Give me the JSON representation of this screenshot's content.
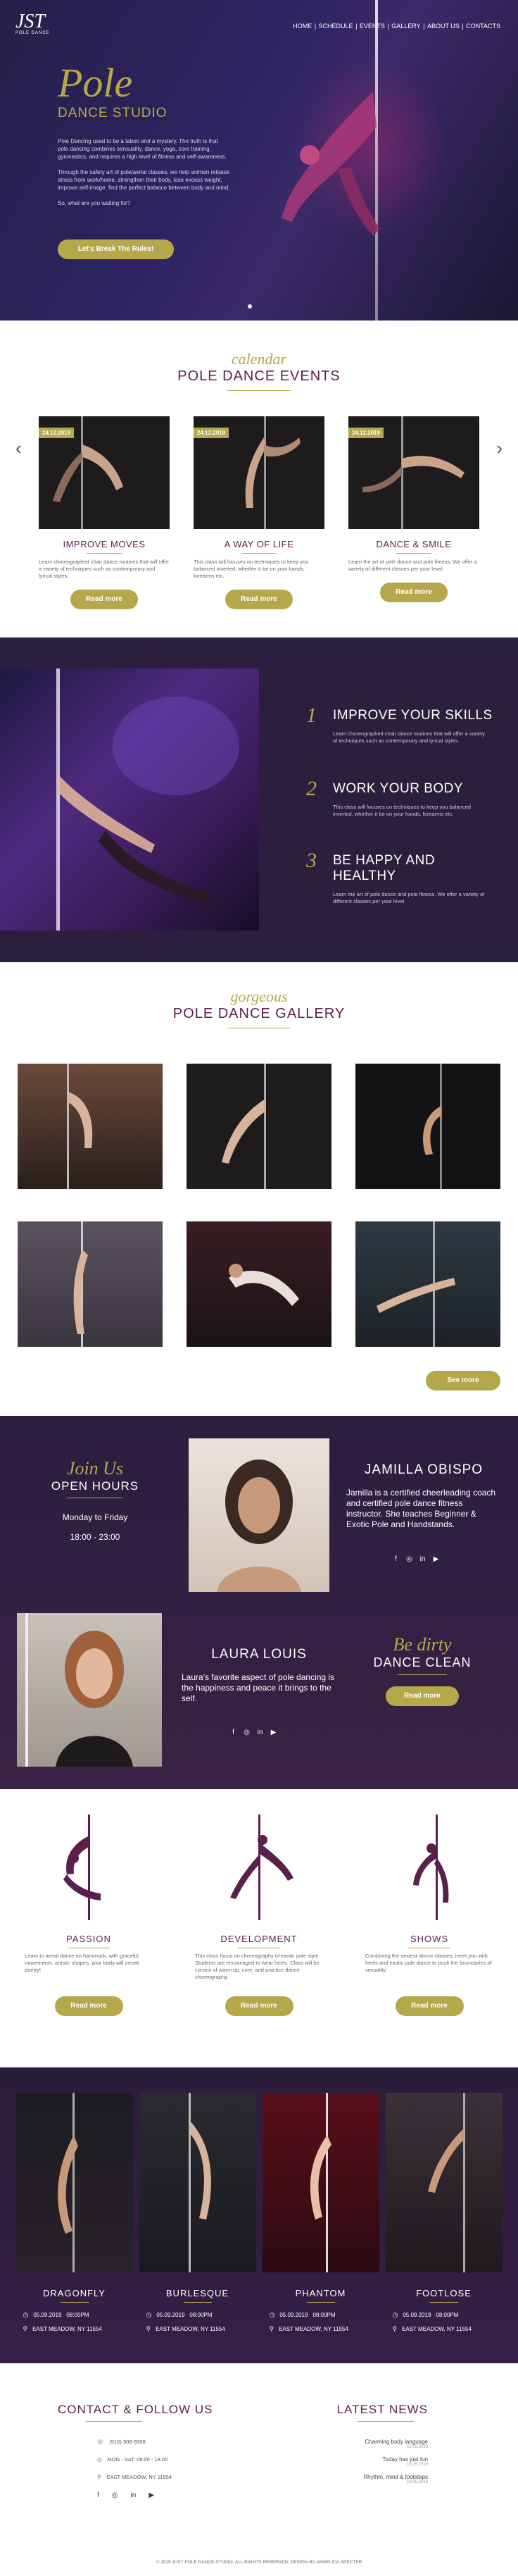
{
  "logo": {
    "mark": "JST",
    "sub": "POLE DANCE"
  },
  "nav": {
    "items": [
      "HOME",
      "SCHEDULE",
      "EVENTS",
      "GALLERY",
      "ABOUT US",
      "CONTACTS"
    ]
  },
  "hero": {
    "title": "Pole",
    "subtitle": "DANCE STUDIO",
    "p1": "Pole Dancing used to be a taboo and a mystery. The truth is that pole dancing combines sensuality, dance, yoga, core training, gymnastics, and requires a high level of fitness and self-awareness.",
    "p2": "Through the safety art of pole/aerial classes, we help women release stress from work/home, strengthen their body, lose excess weight, improve self-image, find the perfect balance between body and mind.",
    "p3": "So, what are you waiting for?",
    "cta": "Let's Break The Rules!"
  },
  "events": {
    "script": "calendar",
    "title": "POLE DANCE EVENTS",
    "items": [
      {
        "date": "24.12.2019",
        "title": "IMPROVE MOVES",
        "text": "Learn choreographed chair dance routines that will offer a variety of techniques such as contemporary and lyrical styles.",
        "button": "Read more"
      },
      {
        "date": "24.12.2019",
        "title": "A WAY OF LIFE",
        "text": "This class will focuses on techniques to keep you balanced inverted, whether it be on your hands, forearms etc.",
        "button": "Read more"
      },
      {
        "date": "24.12.2019",
        "title": "DANCE & SMILE",
        "text": "Learn the art of pole dance and pole fitness. We offer a variety of different classes per your level.",
        "button": "Read more"
      }
    ]
  },
  "skills": {
    "items": [
      {
        "num": "1",
        "title": "IMPROVE YOUR SKILLS",
        "text": "Learn choreographed chair dance routines that will offer a variety of techniques such as contemporary and lyrical styles."
      },
      {
        "num": "2",
        "title": "WORK YOUR BODY",
        "text": "This class will focuses on techniques to keep you balanced inverted, whether it be on your hands, forearms etc."
      },
      {
        "num": "3",
        "title": "BE HAPPY AND HEALTHY",
        "text": "Learn the art of pole dance and pole fitness. We offer a variety of different classes per your level."
      }
    ]
  },
  "gallery": {
    "script": "gorgeous",
    "title": "POLE DANCE GALLERY",
    "button": "See more"
  },
  "team": {
    "open_script": "Join Us",
    "open_title": "OPEN HOURS",
    "days": "Monday to Friday",
    "hours": "18:00 - 23:00",
    "m1_name": "JAMILLA OBISPO",
    "m1_desc": "Jamilla is a certified cheerleading coach and certified pole dance fitness instructor. She teaches Beginner & Exotic Pole and Handstands.",
    "m2_name": "LAURA LOUIS",
    "m2_desc": "Laura's favorite aspect of pole dancing is the happiness and peace it brings to the self.",
    "dirty_script": "Be dirty",
    "dirty_title": "DANCE CLEAN",
    "button": "Read more",
    "social": {
      "facebook": "f",
      "instagram": "◎",
      "linkedin": "in",
      "youtube": "▶"
    }
  },
  "styles": {
    "items": [
      {
        "title": "PASSION",
        "text": "Learn to aerial dance on hammock, with graceful movements, artistic shapes, your body will create poetry!",
        "button": "Read more"
      },
      {
        "title": "DEVELOPMENT",
        "text": "This class focus on choreography of exotic pole style. Students are encouraged to wear heels. Class will be consist of warm up, core, and practice dance choreography.",
        "button": "Read more"
      },
      {
        "title": "SHOWS",
        "text": "Combining the sexiest dance classes, meet you with heels and exotic pole dance to push the boundaries of sexuality.",
        "button": "Read more"
      }
    ]
  },
  "classes": {
    "items": [
      {
        "title": "DRAGONFLY",
        "date": "05.09.2019",
        "time": "08:00PM",
        "address": "EAST MEADOW, NY 11554"
      },
      {
        "title": "BURLESQUE",
        "date": "05.09.2019",
        "time": "08:00PM",
        "address": "EAST MEADOW, NY 11554"
      },
      {
        "title": "PHANTOM",
        "date": "05.09.2019",
        "time": "08:00PM",
        "address": "EAST MEADOW, NY 11554"
      },
      {
        "title": "FOOTLOSE",
        "date": "05.09.2019",
        "time": "08:00PM",
        "address": "EAST MEADOW, NY 11554"
      }
    ]
  },
  "contact": {
    "title": "CONTACT & FOLLOW US",
    "phone": "(516) 908-9308",
    "hours": "MON - SAT: 08:00 - 18:00",
    "address": "EAST MEADOW, NY 11554"
  },
  "news": {
    "title": "LATEST NEWS",
    "items": [
      {
        "title": "Charming body language",
        "date": "10.05.2019"
      },
      {
        "title": "Today has just fun",
        "date": "10.05.2019"
      },
      {
        "title": "Rhythm, mind & footsteps",
        "date": "10.05.2019"
      }
    ]
  },
  "copyright": "© 2019 JUST POLE DANCE STUDIO. ALL RIGHTS RESERVED. DESIGN BY ANGELICA SPECTER",
  "colors": {
    "accent": "#b5a84a",
    "plum": "#5b1f4c",
    "dark": "#2a1f3c"
  }
}
